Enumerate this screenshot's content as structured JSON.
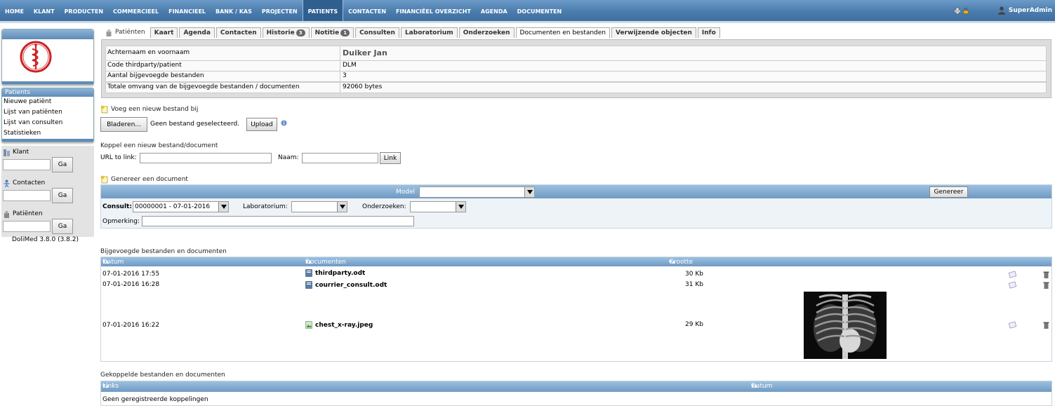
{
  "topmenu": {
    "items": [
      "Home",
      "Klant",
      "Producten",
      "Commercieel",
      "Financieel",
      "Bank / Kas",
      "Projecten",
      "Patients",
      "Contacten",
      "Financiëel overzicht",
      "Agenda",
      "Documenten"
    ],
    "active_index": 7,
    "user": "SuperAdmin"
  },
  "left": {
    "menu_title": "Patients",
    "menu_items": [
      "Nieuwe patiënt",
      "Lijst van patiënten",
      "Lijst van consulten",
      "Statistieken"
    ],
    "search": [
      {
        "label": "Klant",
        "button": "Ga",
        "icon": "building-icon"
      },
      {
        "label": "Contacten",
        "button": "Ga",
        "icon": "contact-icon"
      },
      {
        "label": "Patiënten",
        "button": "Ga",
        "icon": "patient-icon"
      }
    ],
    "version": "DoliMed 3.8.0 (3.8.2)"
  },
  "tabs": {
    "title": "Patiënten",
    "items": [
      {
        "label": "Kaart",
        "badge": ""
      },
      {
        "label": "Agenda",
        "badge": ""
      },
      {
        "label": "Contacten",
        "badge": ""
      },
      {
        "label": "Historie",
        "badge": "3"
      },
      {
        "label": "Notitie",
        "badge": "1"
      },
      {
        "label": "Consulten",
        "badge": ""
      },
      {
        "label": "Laboratorium",
        "badge": ""
      },
      {
        "label": "Onderzoeken",
        "badge": ""
      },
      {
        "label": "Documenten en bestanden",
        "badge": ""
      },
      {
        "label": "Verwijzende objecten",
        "badge": ""
      },
      {
        "label": "Info",
        "badge": ""
      }
    ],
    "active_index": 8
  },
  "info": {
    "rows": [
      {
        "key": "Achternaam en voornaam",
        "value": "Duiker Jan"
      },
      {
        "key": "Code thirdparty/patient",
        "value": "DLM"
      },
      {
        "key": "Aantal bijgevoegde bestanden",
        "value": "3"
      },
      {
        "key": "Totale omvang van de bijgevoegde bestanden / documenten",
        "value": "92060 bytes"
      }
    ]
  },
  "upload": {
    "title": "Voeg een nieuw bestand bij",
    "browse": "Bladeren...",
    "no_file": "Geen bestand geselecteerd.",
    "upload": "Upload"
  },
  "link": {
    "title": "Koppel een nieuw bestand/document",
    "url_label": "URL to link:",
    "name_label": "Naam:",
    "button": "Link"
  },
  "generate": {
    "title": "Genereer een document",
    "model_label": "Model",
    "button": "Genereer",
    "consult_label": "Consult:",
    "consult_value": "00000001 - 07-01-2016",
    "lab_label": "Laboratorium:",
    "exam_label": "Onderzoeken:",
    "remark_label": "Opmerking:"
  },
  "files": {
    "title": "Bijgevoegde bestanden en documenten",
    "col_date": "Datum",
    "col_docs": "Documenten",
    "col_size": "Grootte",
    "rows": [
      {
        "date": "07-01-2016 17:55",
        "name": "thirdparty.odt",
        "size": "30 Kb"
      },
      {
        "date": "07-01-2016 16:28",
        "name": "courrier_consult.odt",
        "size": "31 Kb"
      },
      {
        "date": "07-01-2016 16:22",
        "name": "chest_x-ray.jpeg",
        "size": "29 Kb"
      }
    ]
  },
  "links": {
    "title": "Gekoppelde bestanden en documenten",
    "col_links": "Links",
    "col_date": "Datum",
    "empty": "Geen geregistreerde koppelingen"
  },
  "sort_arrows": "▾▴"
}
